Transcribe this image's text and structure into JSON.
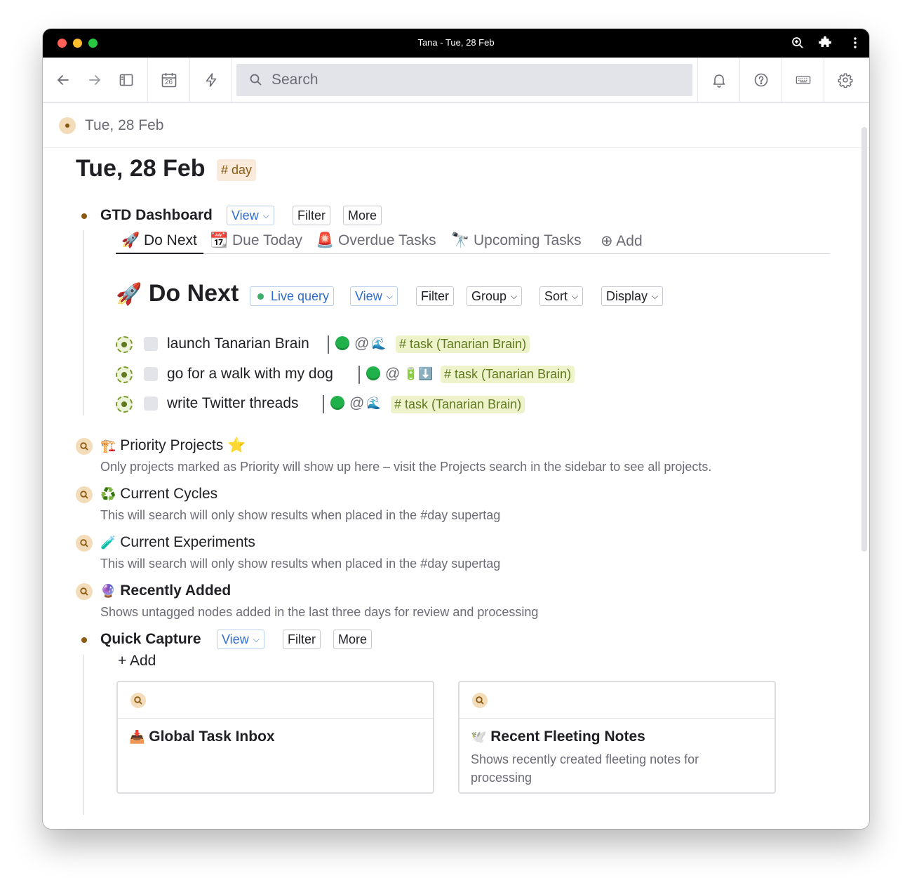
{
  "window": {
    "title": "Tana - Tue, 28 Feb"
  },
  "toolbar": {
    "calendar_day": "26",
    "search_placeholder": "Search"
  },
  "breadcrumb": {
    "label": "Tue, 28 Feb"
  },
  "page": {
    "title": "Tue, 28 Feb",
    "tag": "# day"
  },
  "gtd": {
    "title": "GTD Dashboard",
    "view_label": "View",
    "filter_label": "Filter",
    "more_label": "More",
    "tabs": [
      {
        "icon": "🚀",
        "label": "Do Next"
      },
      {
        "icon": "📆",
        "label": "Due Today"
      },
      {
        "icon": "🚨",
        "label": "Overdue Tasks"
      },
      {
        "icon": "🔭",
        "label": "Upcoming Tasks"
      },
      {
        "icon": "⊕",
        "label": "Add"
      }
    ]
  },
  "do_next": {
    "icon": "🚀",
    "title": "Do Next",
    "live_query_label": "Live query",
    "view_label": "View",
    "filter_label": "Filter",
    "group_label": "Group",
    "sort_label": "Sort",
    "display_label": "Display",
    "tasks": [
      {
        "text": "launch Tanarian Brain",
        "at": "@",
        "emoji": "🌊",
        "tag": "# task (Tanarian Brain)"
      },
      {
        "text": "go for a walk with my dog",
        "at": "@",
        "emoji": "🔋⬇️",
        "tag": "# task (Tanarian Brain)"
      },
      {
        "text": "write Twitter threads",
        "at": "@",
        "emoji": "🌊",
        "tag": "# task (Tanarian Brain)"
      }
    ]
  },
  "searches": [
    {
      "icon": "🏗️",
      "title": "Priority Projects ⭐",
      "desc": "Only projects marked as Priority will show up here – visit the Projects search in the sidebar to see all projects."
    },
    {
      "icon": "♻️",
      "title": "Current Cycles",
      "desc": "This will search will only show results when placed in the #day supertag"
    },
    {
      "icon": "🧪",
      "title": "Current Experiments",
      "desc": "This will search will only show results when placed in the #day supertag"
    },
    {
      "icon": "🔮",
      "title": "Recently Added",
      "desc": "Shows untagged nodes added in the last three days for review and processing"
    }
  ],
  "quick_capture": {
    "title": "Quick Capture",
    "view_label": "View",
    "filter_label": "Filter",
    "more_label": "More",
    "add_label": "+  Add",
    "cards": [
      {
        "icon": "📥",
        "title": "Global Task Inbox",
        "desc": ""
      },
      {
        "icon": "🕊️",
        "title": "Recent Fleeting Notes",
        "desc": "Shows recently created fleeting notes for processing"
      }
    ]
  },
  "colors": {
    "accent_blue": "#2d6ccf",
    "tag_day_bg": "#faeadb",
    "tag_task_bg": "#eef3cc",
    "bullet": "#8a5a12"
  }
}
